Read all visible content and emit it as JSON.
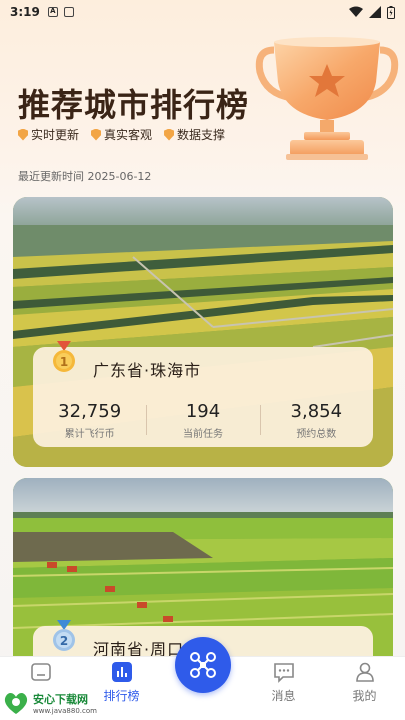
{
  "status_bar": {
    "time": "3:19",
    "icon_a": "A"
  },
  "hero": {
    "title": "推荐城市排行榜",
    "badges": [
      "实时更新",
      "真实客观",
      "数据支撑"
    ],
    "update_label": "最近更新时间",
    "update_date": "2025-06-12"
  },
  "rankings": [
    {
      "rank": "1",
      "city": "广东省·珠海市",
      "stats": [
        {
          "value": "32,759",
          "label": "累计飞行币"
        },
        {
          "value": "194",
          "label": "当前任务"
        },
        {
          "value": "3,854",
          "label": "预约总数"
        }
      ]
    },
    {
      "rank": "2",
      "city": "河南省·周口市"
    }
  ],
  "bottom_nav": {
    "items": [
      {
        "label": "",
        "icon": "home-icon"
      },
      {
        "label": "排行榜",
        "icon": "ranking-icon"
      },
      {
        "label": "",
        "icon": "drone-icon"
      },
      {
        "label": "消息",
        "icon": "message-icon"
      },
      {
        "label": "我的",
        "icon": "profile-icon"
      }
    ]
  },
  "watermark": {
    "brand": "安心下载网",
    "url": "www.java880.com"
  },
  "colors": {
    "accent": "#2f5bea",
    "gold": "#f2a545",
    "title": "#3a2416"
  }
}
